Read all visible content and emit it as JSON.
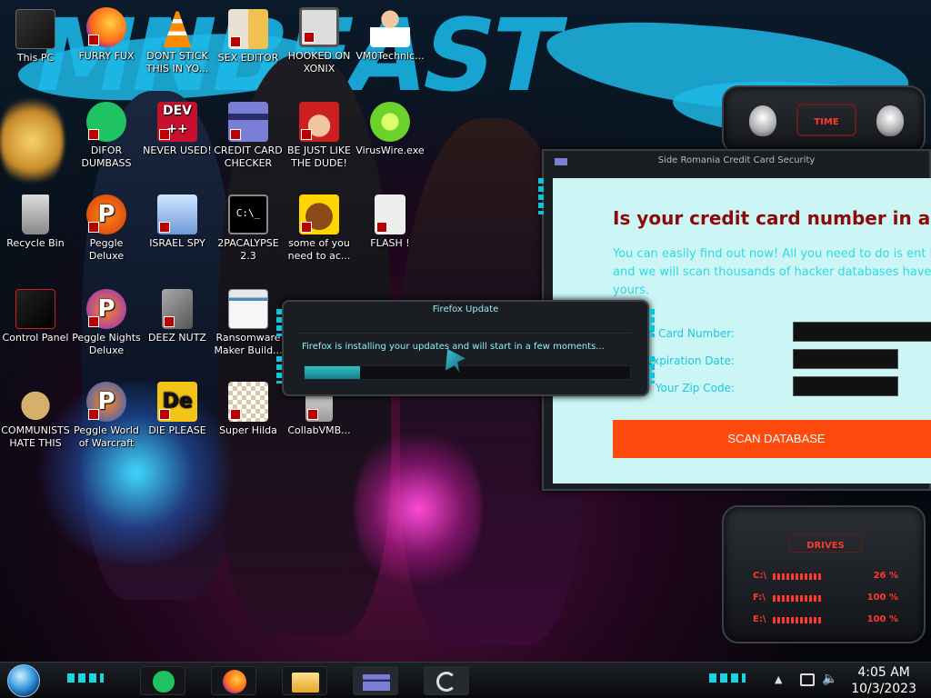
{
  "desktop": {
    "icons": [
      {
        "label": "This PC"
      },
      {
        "label": "FURRY FUX"
      },
      {
        "label": "DONT STICK THIS IN YO..."
      },
      {
        "label": "SEX EDITOR"
      },
      {
        "label": "HOOKED ON XONIX"
      },
      {
        "label": "VM0Technic..."
      },
      {
        "label": "DIFOR DUMBASS"
      },
      {
        "label": "NEVER USED!"
      },
      {
        "label": "CREDIT CARD CHECKER"
      },
      {
        "label": "BE JUST LIKE THE DUDE!"
      },
      {
        "label": "VirusWire.exe"
      },
      {
        "label": "Recycle Bin"
      },
      {
        "label": "Peggle Deluxe"
      },
      {
        "label": "ISRAEL SPY"
      },
      {
        "label": "2PACALYPSE 2.3"
      },
      {
        "label": "some of you need to ac..."
      },
      {
        "label": "FLASH !"
      },
      {
        "label": "Control Panel"
      },
      {
        "label": "Peggle Nights Deluxe"
      },
      {
        "label": "DEEZ NUTZ"
      },
      {
        "label": "Ransomware Maker Build..."
      },
      {
        "label": "COMMUNISTS HATE THIS G..."
      },
      {
        "label": "Peggle World of Warcraft"
      },
      {
        "label": "DIE PLEASE"
      },
      {
        "label": "Super Hilda"
      },
      {
        "label": "CollabVMB..."
      }
    ]
  },
  "icon_text": {
    "dev": "DEV",
    "dev_sub": "++",
    "peggle": "P",
    "die": "De",
    "cmd": "C:\\_"
  },
  "gadgets": {
    "time_label": "TIME",
    "drives_label": "DRIVES",
    "drives": [
      {
        "letter": "C:\\",
        "percent": "26 %"
      },
      {
        "letter": "F:\\",
        "percent": "100 %"
      },
      {
        "letter": "E:\\",
        "percent": "100 %"
      }
    ]
  },
  "cc_window": {
    "title": "Side Romania Credit Card Security",
    "headline": "Is your credit card number in a hacke",
    "description": "You can easily find out now! All you need to do is ent here and we will scan thousands of hacker databases have match yours.",
    "fields": [
      {
        "label": "Credit Card Number:",
        "value": ""
      },
      {
        "label": "Expiration Date:",
        "value": ""
      },
      {
        "label": "Your Zip Code:",
        "value": ""
      }
    ],
    "scan_button": "SCAN DATABASE"
  },
  "firefox_update": {
    "title": "Firefox Update",
    "message": "Firefox is installing your updates and will start in a few moments...",
    "progress": 0.17
  },
  "taskbar": {
    "time": "4:05 AM",
    "date": "10/3/2023"
  },
  "colors": {
    "accent_teal": "#1ad4e4",
    "headline_red": "#8b0a0a",
    "scan_orange": "#ff4a0e",
    "page_bg": "#ccf6f6"
  }
}
